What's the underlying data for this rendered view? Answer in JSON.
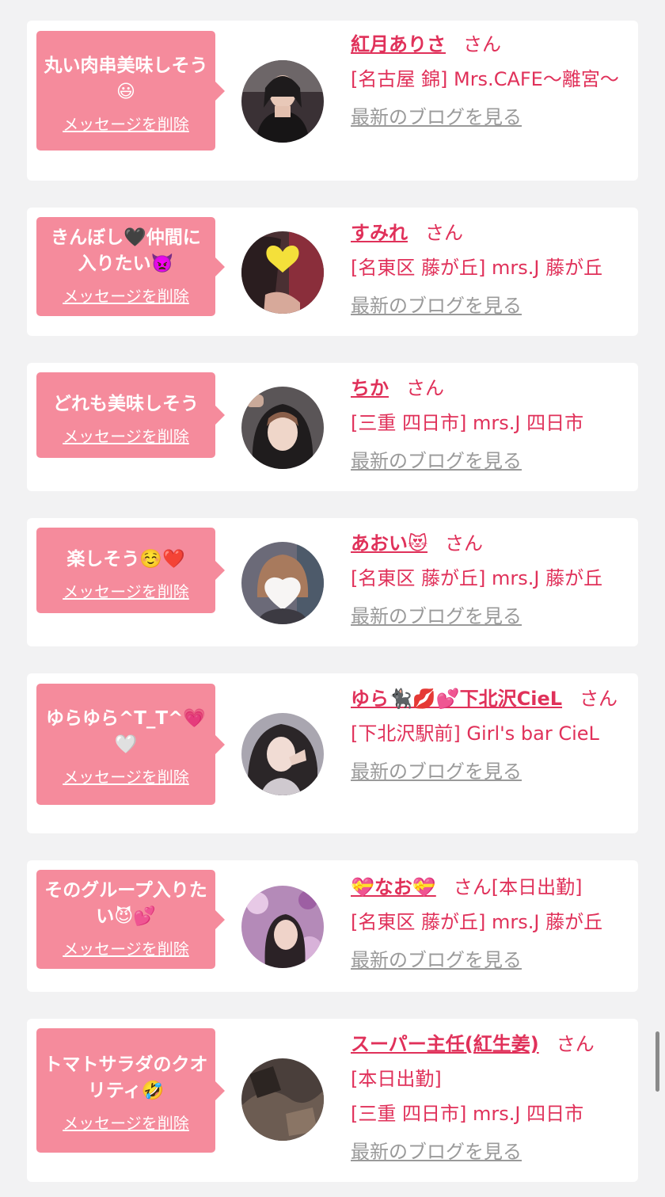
{
  "entries": [
    {
      "message": "丸い肉串美味しそう😃",
      "delete_label": "メッセージを削除",
      "name": "紅月ありさ",
      "san": "さん",
      "status": "",
      "shop": "[名古屋 錦] Mrs.CAFE～離宮～",
      "blog": "最新のブログを見る"
    },
    {
      "message": "きんぼし🖤仲間に入りたい👿",
      "delete_label": "メッセージを削除",
      "name": "すみれ",
      "san": "さん",
      "status": "",
      "shop": "[名東区 藤が丘] mrs.J 藤が丘",
      "blog": "最新のブログを見る"
    },
    {
      "message": "どれも美味しそう",
      "delete_label": "メッセージを削除",
      "name": "ちか",
      "san": "さん",
      "status": "",
      "shop": "[三重 四日市] mrs.J 四日市",
      "blog": "最新のブログを見る"
    },
    {
      "message": "楽しそう☺️❤️",
      "delete_label": "メッセージを削除",
      "name": "あおい😻",
      "san": "さん",
      "status": "",
      "shop": "[名東区 藤が丘] mrs.J 藤が丘",
      "blog": "最新のブログを見る"
    },
    {
      "message": "ゆらゆら^T_T^💗🤍",
      "delete_label": "メッセージを削除",
      "name": "ゆら🐈‍⬛💋💕下北沢CieL",
      "san": "さん",
      "status": "",
      "shop": "[下北沢駅前] Girl's bar CieL",
      "blog": "最新のブログを見る"
    },
    {
      "message": "そのグループ入りたい😈💕",
      "delete_label": "メッセージを削除",
      "name": "💝なお💝",
      "san": "さん",
      "status": "[本日出勤]",
      "shop": "[名東区 藤が丘] mrs.J 藤が丘",
      "blog": "最新のブログを見る"
    },
    {
      "message": "トマトサラダのクオリティ🤣",
      "delete_label": "メッセージを削除",
      "name": "スーパー主任(紅生姜)",
      "san": "さん",
      "status": "[本日出勤]",
      "shop": "[三重 四日市] mrs.J 四日市",
      "blog": "最新のブログを見る"
    }
  ]
}
